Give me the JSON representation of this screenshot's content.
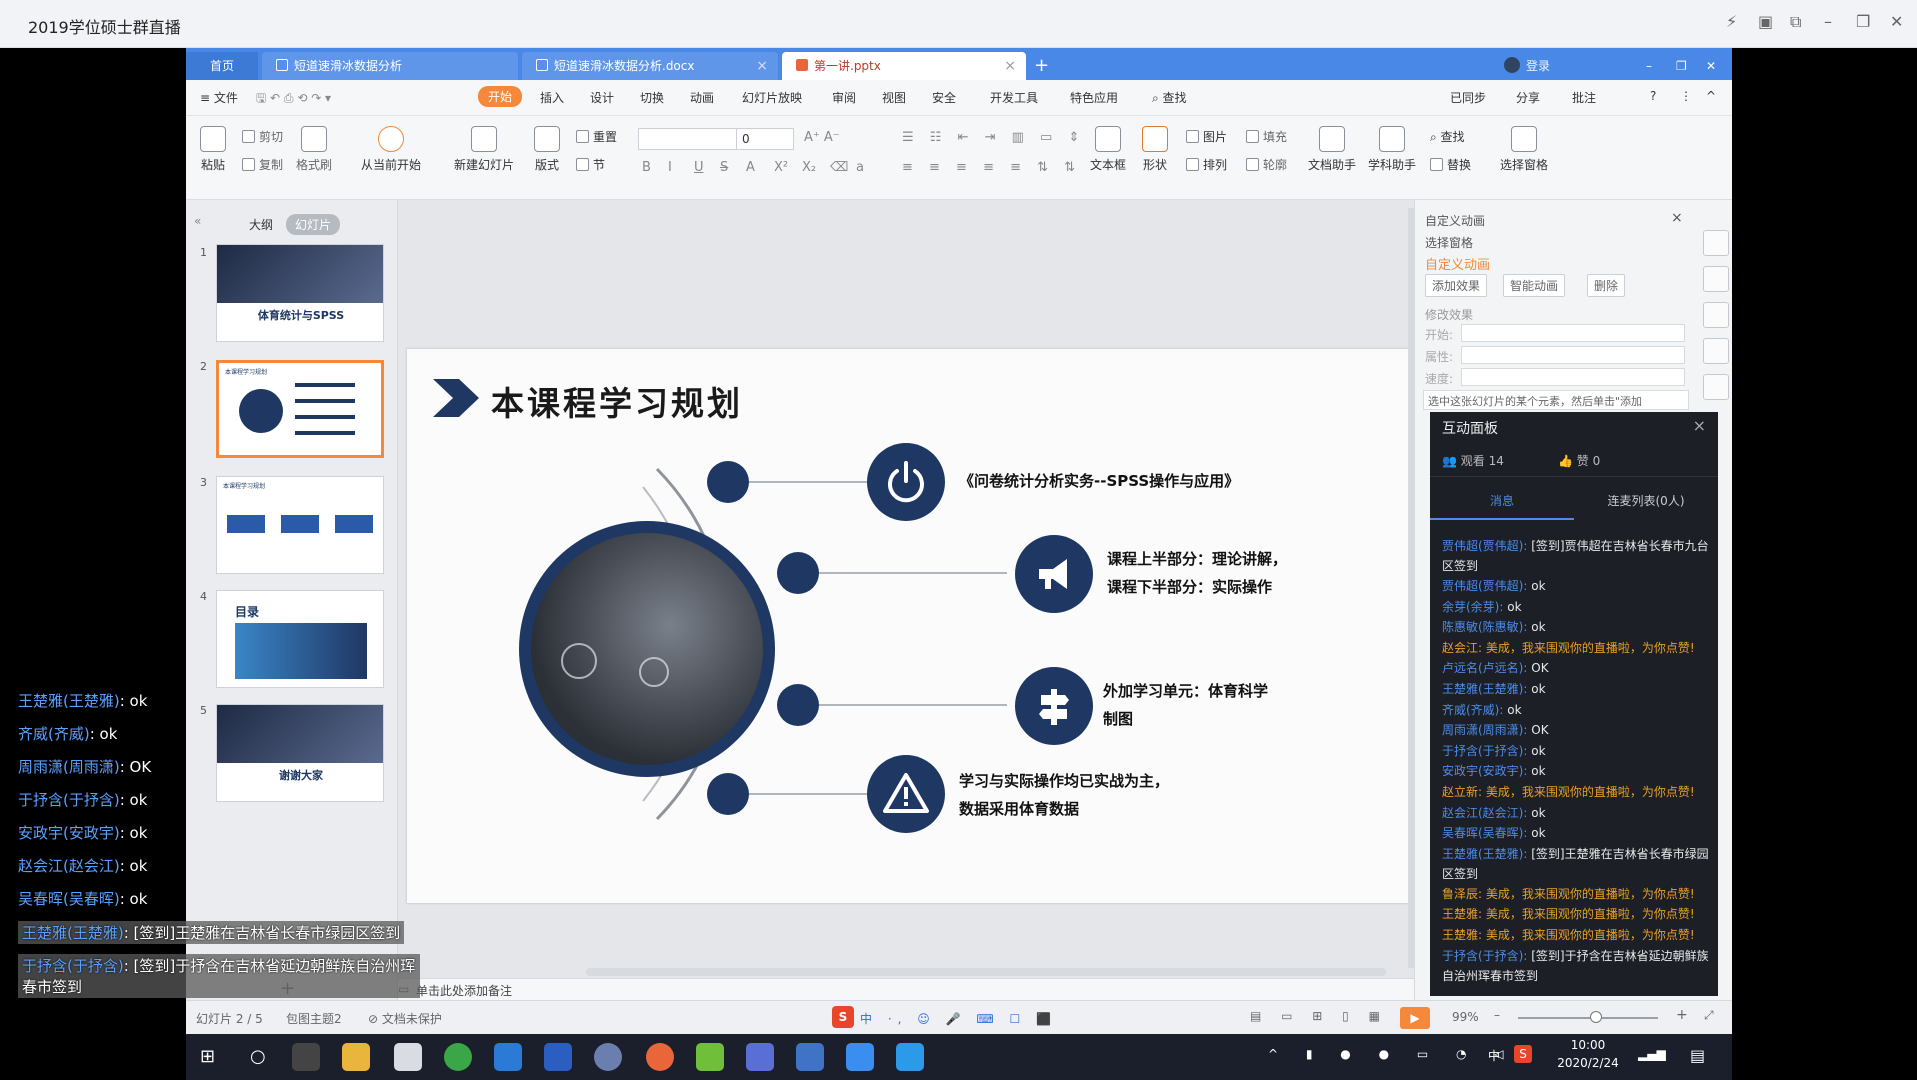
{
  "app": {
    "title": "2019学位硕士群直播",
    "controls": [
      "⚡",
      "▣",
      "⧉",
      "–",
      "❐",
      "✕"
    ]
  },
  "wps": {
    "tabs": [
      {
        "label": "首页"
      },
      {
        "label": "短道速滑冰数据分析"
      },
      {
        "label": "短道速滑冰数据分析.docx"
      },
      {
        "label": "第一讲.pptx"
      }
    ],
    "tab_add": "+",
    "user": "登录",
    "menu": [
      "≡ 文件",
      "开始",
      "插入",
      "设计",
      "切换",
      "动画",
      "幻灯片放映",
      "审阅",
      "视图",
      "安全",
      "开发工具",
      "特色应用",
      "查找"
    ],
    "menu_right": [
      "已同步",
      "分享",
      "批注",
      "?",
      "⋮",
      "^"
    ],
    "ribbon": {
      "paste": "粘贴",
      "cut": "剪切",
      "copy": "复制",
      "format_painter": "格式刷",
      "from_start": "从当前开始",
      "new_slide": "新建幻灯片",
      "layout": "版式",
      "reset": "重置",
      "section": "节",
      "font_size": "0",
      "textbox": "文本框",
      "shape": "形状",
      "picture": "图片",
      "fill": "填充",
      "arrange": "排列",
      "outline": "轮廓",
      "doc_helper": "文档助手",
      "study_helper": "学科助手",
      "find": "查找",
      "replace": "替换",
      "select_pane": "选择窗格",
      "fmt": [
        "B",
        "I",
        "U",
        "S",
        "A",
        "X²",
        "X₂",
        "⌫",
        "a"
      ]
    }
  },
  "left_panel": {
    "tabs": [
      "大纲",
      "幻灯片"
    ],
    "slides": [
      {
        "num": "1",
        "caption": "体育统计与SPSS"
      },
      {
        "num": "2",
        "caption": "本课程学习规划"
      },
      {
        "num": "3",
        "caption": "本课程学习规划"
      },
      {
        "num": "4",
        "caption": "目录"
      },
      {
        "num": "5",
        "caption": "谢谢大家"
      }
    ],
    "add": "+"
  },
  "slide": {
    "title": "本课程学习规划",
    "items": [
      {
        "text": "《问卷统计分析实务--SPSS操作与应用》",
        "icon": "power-icon"
      },
      {
        "text": "课程上半部分：理论讲解，\n课程下半部分：实际操作",
        "icon": "megaphone-icon"
      },
      {
        "text": "外加学习单元：体育科学\n制图",
        "icon": "signpost-icon"
      },
      {
        "text": "学习与实际操作均已实战为主，\n数据采用体育数据",
        "icon": "warning-icon"
      }
    ]
  },
  "notes": "单击此处添加备注",
  "right_pane": {
    "header": "自定义动画",
    "select_pane": "选择窗格",
    "section": "自定义动画",
    "add_effect": "添加效果",
    "smart_anim": "智能动画",
    "delete": "删除",
    "modify": "修改效果",
    "start": "开始:",
    "property": "属性:",
    "speed": "速度:",
    "hint": "选中这张幻灯片的某个元素，然后单击\"添加"
  },
  "interaction": {
    "title": "互动面板",
    "viewers": "观看 14",
    "likes": "赞 0",
    "tab_messages": "消息",
    "tab_mic": "连麦列表(0人)",
    "messages": [
      {
        "name": "贾伟超(贾伟超):",
        "text": "[签到]贾伟超在吉林省长春市九台区签到",
        "gift": false
      },
      {
        "name": "贾伟超(贾伟超):",
        "text": "ok",
        "gift": false
      },
      {
        "name": "余芽(余芽):",
        "text": "ok",
        "gift": false
      },
      {
        "name": "陈惠敏(陈惠敏):",
        "text": "ok",
        "gift": false
      },
      {
        "name": "赵会江:",
        "text": "美成，我来围观你的直播啦，为你点赞!",
        "gift": true
      },
      {
        "name": "卢远名(卢远名):",
        "text": "OK",
        "gift": false
      },
      {
        "name": "王楚雅(王楚雅):",
        "text": "ok",
        "gift": false
      },
      {
        "name": "齐威(齐威):",
        "text": "ok",
        "gift": false
      },
      {
        "name": "周雨潇(周雨潇):",
        "text": "OK",
        "gift": false
      },
      {
        "name": "于抒含(于抒含):",
        "text": "ok",
        "gift": false
      },
      {
        "name": "安政宇(安政宇):",
        "text": "ok",
        "gift": false
      },
      {
        "name": "赵立新:",
        "text": "美成，我来围观你的直播啦，为你点赞!",
        "gift": true
      },
      {
        "name": "赵会江(赵会江):",
        "text": "ok",
        "gift": false
      },
      {
        "name": "吴春晖(吴春晖):",
        "text": "ok",
        "gift": false
      },
      {
        "name": "王楚雅(王楚雅):",
        "text": "[签到]王楚雅在吉林省长春市绿园区签到",
        "gift": false
      },
      {
        "name": "鲁泽辰:",
        "text": "美成，我来围观你的直播啦，为你点赞!",
        "gift": true
      },
      {
        "name": "王楚雅:",
        "text": "美成，我来围观你的直播啦，为你点赞!",
        "gift": true
      },
      {
        "name": "王楚雅:",
        "text": "美成，我来围观你的直播啦，为你点赞!",
        "gift": true
      },
      {
        "name": "于抒含(于抒含):",
        "text": "[签到]于抒含在吉林省延边朝鲜族自治州珲春市签到",
        "gift": false
      }
    ]
  },
  "status": {
    "slide_pos": "幻灯片 2 / 5",
    "theme": "包图主题2",
    "protect": "文档未保护",
    "zoom": "99%"
  },
  "taskbar": {
    "time": "10:00",
    "date": "2020/2/24",
    "ime": "中"
  },
  "danmaku": [
    {
      "name": "王楚雅(王楚雅)",
      "text": ": ok",
      "box": false
    },
    {
      "name": "齐威(齐威)",
      "text": ": ok",
      "box": false
    },
    {
      "name": "周雨潇(周雨潇)",
      "text": ": OK",
      "box": false
    },
    {
      "name": "于抒含(于抒含)",
      "text": ": ok",
      "box": false
    },
    {
      "name": "安政宇(安政宇)",
      "text": ": ok",
      "box": false
    },
    {
      "name": "赵会江(赵会江)",
      "text": ": ok",
      "box": false
    },
    {
      "name": "吴春晖(吴春晖)",
      "text": ": ok",
      "box": false
    },
    {
      "name": "王楚雅(王楚雅)",
      "text": ": [签到]王楚雅在吉林省长春市绿园区签到",
      "box": true
    },
    {
      "name": "于抒含(于抒含)",
      "text": ": [签到]于抒含在吉林省延边朝鲜族自治州珲春市签到",
      "box": true
    }
  ],
  "colors": {
    "wps_blue": "#4a88e8",
    "accent_orange": "#f5883a",
    "slide_navy": "#1f3763",
    "name_blue": "#4c8be8",
    "gift_orange": "#e8a028"
  }
}
